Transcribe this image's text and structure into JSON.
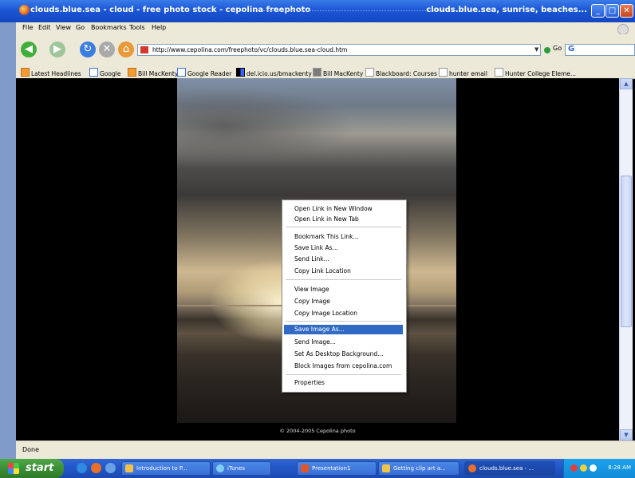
{
  "window": {
    "title_left": "clouds.blue.sea - cloud - free photo stock - cepolina freephoto",
    "title_right": "clouds.blue.sea, sunrise, beaches..."
  },
  "menubar": {
    "items": [
      "File",
      "Edit",
      "View",
      "Go",
      "Bookmarks",
      "Tools",
      "Help"
    ]
  },
  "navbar": {
    "url": "http://www.cepolina.com/freephoto/vc/clouds.blue.sea-cloud.htm",
    "go_label": "Go",
    "search_value": "G"
  },
  "bookmarks": [
    "Latest Headlines",
    "Google",
    "Bill MacKenty",
    "Google Reader",
    "del.icio.us/bmackenty",
    "Bill MacKenty",
    "Blackboard: Courses",
    "hunter email",
    "Hunter College Eleme..."
  ],
  "content": {
    "copyright": "© 2004-2005 Cepolina photo"
  },
  "context_menu": {
    "groups": [
      [
        "Open Link in New Window",
        "Open Link in New Tab"
      ],
      [
        "Bookmark This Link...",
        "Save Link As...",
        "Send Link...",
        "Copy Link Location"
      ],
      [
        "View Image",
        "Copy Image",
        "Copy Image Location"
      ],
      [
        "Save Image As...",
        "Send Image...",
        "Set As Desktop Background...",
        "Block Images from cepolina.com"
      ],
      [
        "Properties"
      ]
    ],
    "selected": "Save Image As..."
  },
  "status": {
    "text": "Done"
  },
  "taskbar": {
    "start_label": "start",
    "tasks": [
      "Introduction to P...",
      "iTunes",
      "Presentation1",
      "Getting clip art a...",
      "clouds.blue.sea - ..."
    ],
    "active_task": "clouds.blue.sea - ...",
    "clock": "8:28 AM"
  }
}
